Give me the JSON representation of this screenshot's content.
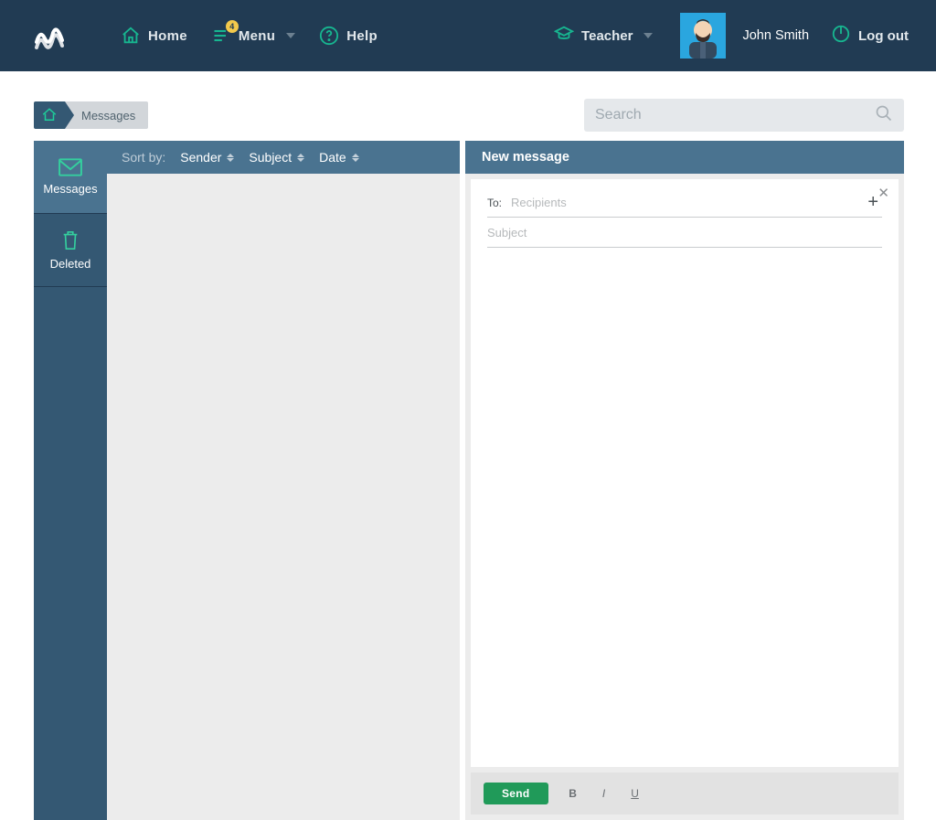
{
  "header": {
    "nav": {
      "home": "Home",
      "menu": "Menu",
      "menu_badge": "4",
      "help": "Help"
    },
    "role": "Teacher",
    "username": "John Smith",
    "logout": "Log out"
  },
  "breadcrumb": {
    "current": "Messages"
  },
  "search": {
    "placeholder": "Search"
  },
  "sidebar": {
    "messages": "Messages",
    "deleted": "Deleted"
  },
  "sort": {
    "label": "Sort by:",
    "sender": "Sender",
    "subject": "Subject",
    "date": "Date"
  },
  "compose": {
    "title": "New message",
    "to_label": "To:",
    "to_placeholder": "Recipients",
    "subject_placeholder": "Subject",
    "send": "Send",
    "fmt_bold": "B",
    "fmt_italic": "I",
    "fmt_underline": "U"
  }
}
